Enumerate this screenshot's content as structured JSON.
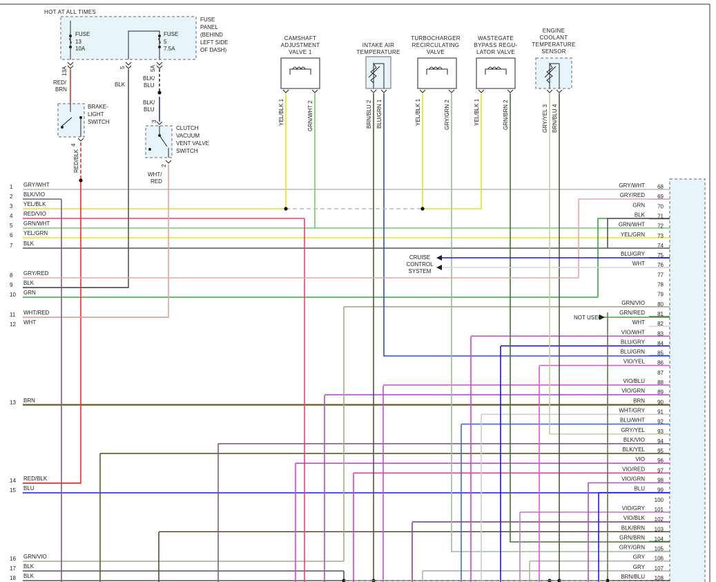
{
  "header": {
    "hot_at_all_times": "HOT AT ALL TIMES"
  },
  "fuse_panel": {
    "label": [
      "FUSE",
      "PANEL",
      "(BEHIND",
      "LEFT SIDE",
      "OF DASH)"
    ],
    "fuse13": [
      "FUSE",
      "13",
      "10A"
    ],
    "fuse5": [
      "FUSE",
      "5",
      "7.5A"
    ]
  },
  "upper_wires": {
    "w13a": "13A",
    "red_brn": [
      "RED/",
      "BRN"
    ],
    "w5": "5",
    "blk": "BLK",
    "w5a": "5A",
    "blk_blu_1": [
      "BLK/",
      "BLU"
    ],
    "blk_blu_2": [
      "BLK/",
      "BLU"
    ],
    "pin3": "3",
    "pin2": "2",
    "whtred": [
      "WHT/",
      "RED"
    ],
    "pin4": "4",
    "redblk": "RED/BLK"
  },
  "brake_switch": [
    "BRAKE-",
    "LIGHT",
    "SWITCH"
  ],
  "clutch_switch": [
    "CLUTCH",
    "VACUUM",
    "VENT VALVE",
    "SWITCH"
  ],
  "components": [
    {
      "title": [
        "CAMSHAFT",
        "ADJUSTMENT",
        "VALVE 1"
      ],
      "pins": [
        "YEL/BLK 1",
        "GRN/WHT 2"
      ]
    },
    {
      "title": [
        "INTAKE AIR",
        "TEMPERATURE"
      ],
      "pins": [
        "BRN/BLU 2",
        "BLU/GRN 1"
      ]
    },
    {
      "title": [
        "TURBOCHARGER",
        "RECIRCULATING",
        "VALVE"
      ],
      "pins": [
        "YEL/BLK 1",
        "GRY/GRN 2"
      ]
    },
    {
      "title": [
        "WASTEGATE",
        "BYPASS REGU-",
        "LATOR VALVE"
      ],
      "pins": [
        "YEL/BLK 1",
        "GRN/BRN 2"
      ]
    },
    {
      "title": [
        "ENGINE",
        "COOLANT",
        "TEMPERATURE",
        "SENSOR"
      ],
      "pins": [
        "GRY/YEL 3",
        "BRN/BLU 4"
      ]
    }
  ],
  "cruise": [
    "CRUISE",
    "CONTROL",
    "SYSTEM"
  ],
  "not_used": "NOT USED",
  "left_pins": [
    {
      "n": "1",
      "label": "GRY/WHT",
      "color": "#b8b8b8"
    },
    {
      "n": "2",
      "label": "BLK/VIO",
      "color": "#7b5c86"
    },
    {
      "n": "3",
      "label": "YEL/BLK",
      "color": "#e7e31a"
    },
    {
      "n": "4",
      "label": "RED/VIO",
      "color": "#ef3f72"
    },
    {
      "n": "5",
      "label": "GRN/WHT",
      "color": "#6ccf6c"
    },
    {
      "n": "6",
      "label": "YEL/GRN",
      "color": "#e7e31a"
    },
    {
      "n": "7",
      "label": "BLK",
      "color": "#555555"
    },
    {
      "n": "8",
      "label": "GRY/RED",
      "color": "#e0a9a9"
    },
    {
      "n": "9",
      "label": "BLK",
      "color": "#555555"
    },
    {
      "n": "10",
      "label": "GRN",
      "color": "#3aa83a"
    },
    {
      "n": "11",
      "label": "WHT/RED",
      "color": "#e8a0a0"
    },
    {
      "n": "12",
      "label": "WHT",
      "color": "#d6d6d6"
    },
    {
      "n": "13",
      "label": "BRN",
      "color": "#6b5a1e"
    },
    {
      "n": "14",
      "label": "RED/BLK",
      "color": "#e53323"
    },
    {
      "n": "15",
      "label": "BLU",
      "color": "#1a1aea"
    },
    {
      "n": "16",
      "label": "GRN/VIO",
      "color": "#9db07c"
    },
    {
      "n": "17",
      "label": "BLK",
      "color": "#555555"
    },
    {
      "n": "18",
      "label": "BLK",
      "color": "#555555"
    }
  ],
  "right_pins": [
    {
      "n": "68",
      "label": "GRY/WHT",
      "color": "#b8b8b8"
    },
    {
      "n": "69",
      "label": "GRY/RED",
      "color": "#e0a9a9"
    },
    {
      "n": "70",
      "label": "GRN",
      "color": "#3aa83a"
    },
    {
      "n": "71",
      "label": "BLK",
      "color": "#555555"
    },
    {
      "n": "72",
      "label": "GRN/WHT",
      "color": "#6ccf6c"
    },
    {
      "n": "73",
      "label": "YEL/GRN",
      "color": "#e7e31a"
    },
    {
      "n": "74",
      "label": "",
      "color": ""
    },
    {
      "n": "75",
      "label": "BLU/GRY",
      "color": "#1a1ab8"
    },
    {
      "n": "76",
      "label": "WHT",
      "color": "#d6d6d6"
    },
    {
      "n": "77",
      "label": "",
      "color": ""
    },
    {
      "n": "78",
      "label": "",
      "color": ""
    },
    {
      "n": "79",
      "label": "",
      "color": ""
    },
    {
      "n": "80",
      "label": "GRN/VIO",
      "color": "#9db07c"
    },
    {
      "n": "81",
      "label": "GRN/RED",
      "color": "#7a6a55"
    },
    {
      "n": "82",
      "label": "WHT",
      "color": "#d6d6d6"
    },
    {
      "n": "83",
      "label": "VIO/WHT",
      "color": "#d63fd6"
    },
    {
      "n": "84",
      "label": "BLU/GRY",
      "color": "#1a1ab8"
    },
    {
      "n": "85",
      "label": "BLU/GRN",
      "color": "#2b4fd8"
    },
    {
      "n": "86",
      "label": "VIO/YEL",
      "color": "#e84fe8"
    },
    {
      "n": "87",
      "label": "",
      "color": ""
    },
    {
      "n": "88",
      "label": "VIO/BLU",
      "color": "#c04fd0"
    },
    {
      "n": "89",
      "label": "VIO/GRN",
      "color": "#b04fc8"
    },
    {
      "n": "90",
      "label": "BRN",
      "color": "#6b5a1e"
    },
    {
      "n": "91",
      "label": "WHT/GRY",
      "color": "#cccccc"
    },
    {
      "n": "92",
      "label": "BLU/WHT",
      "color": "#3a6ae0"
    },
    {
      "n": "93",
      "label": "GRY/YEL",
      "color": "#c9cf99"
    },
    {
      "n": "94",
      "label": "BLK/VIO",
      "color": "#7b5c86"
    },
    {
      "n": "95",
      "label": "BLK/YEL",
      "color": "#5a5a30"
    },
    {
      "n": "96",
      "label": "VIO",
      "color": "#e03fe0"
    },
    {
      "n": "97",
      "label": "VIO/RED",
      "color": "#e03fa8"
    },
    {
      "n": "98",
      "label": "VIO/GRN",
      "color": "#b04fc8"
    },
    {
      "n": "99",
      "label": "BLU",
      "color": "#1a1aea"
    },
    {
      "n": "100",
      "label": "",
      "color": ""
    },
    {
      "n": "101",
      "label": "VIO/GRY",
      "color": "#c080c0"
    },
    {
      "n": "102",
      "label": "VIO/BLK",
      "color": "#8a3f8a"
    },
    {
      "n": "103",
      "label": "BLK/BRN",
      "color": "#5a4a30"
    },
    {
      "n": "104",
      "label": "GRN/BRN",
      "color": "#3a7a2a"
    },
    {
      "n": "105",
      "label": "GRY/GRN",
      "color": "#a0b8a0"
    },
    {
      "n": "106",
      "label": "GRY",
      "color": "#b0b0b0"
    },
    {
      "n": "107",
      "label": "GRY",
      "color": "#b0b0b0"
    },
    {
      "n": "108",
      "label": "BRN/BLU",
      "color": "#5a5040"
    }
  ]
}
